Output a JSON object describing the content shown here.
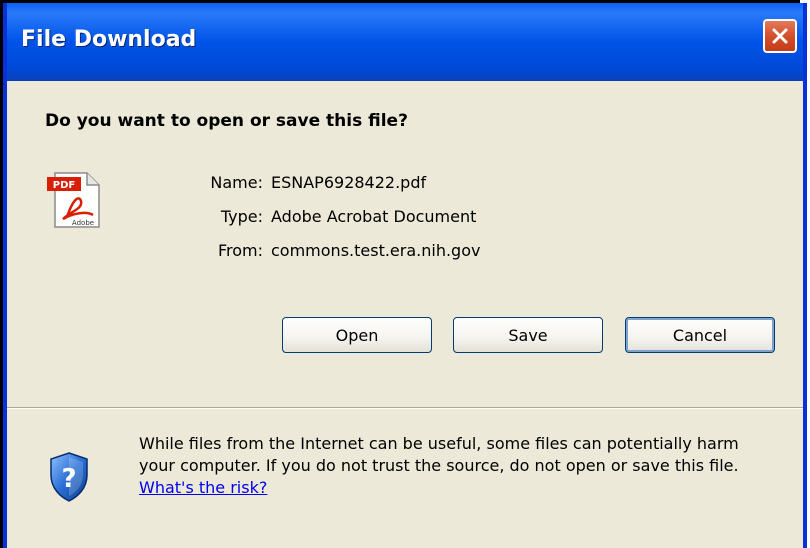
{
  "window": {
    "title": "File Download"
  },
  "dialog": {
    "question": "Do you want to open or save this file?",
    "file_icon": "pdf-file-icon",
    "file_icon_text": "PDF",
    "file_icon_brand": "Adobe",
    "info": [
      {
        "label": "Name:",
        "value": "ESNAP6928422.pdf"
      },
      {
        "label": "Type:",
        "value": "Adobe Acrobat Document"
      },
      {
        "label": "From:",
        "value": "commons.test.era.nih.gov"
      }
    ],
    "buttons": {
      "open": "Open",
      "save": "Save",
      "cancel": "Cancel"
    },
    "warning": {
      "icon": "security-shield-icon",
      "text": "While files from the Internet can be useful, some files can potentially harm your computer. If you do not trust the source, do not open or save this file.",
      "link_text": "What's the risk?"
    }
  },
  "colors": {
    "titlebar": "#0053e8",
    "dialog_background": "#ece9d8",
    "close_button": "#d4502b",
    "link": "#0000ee"
  }
}
